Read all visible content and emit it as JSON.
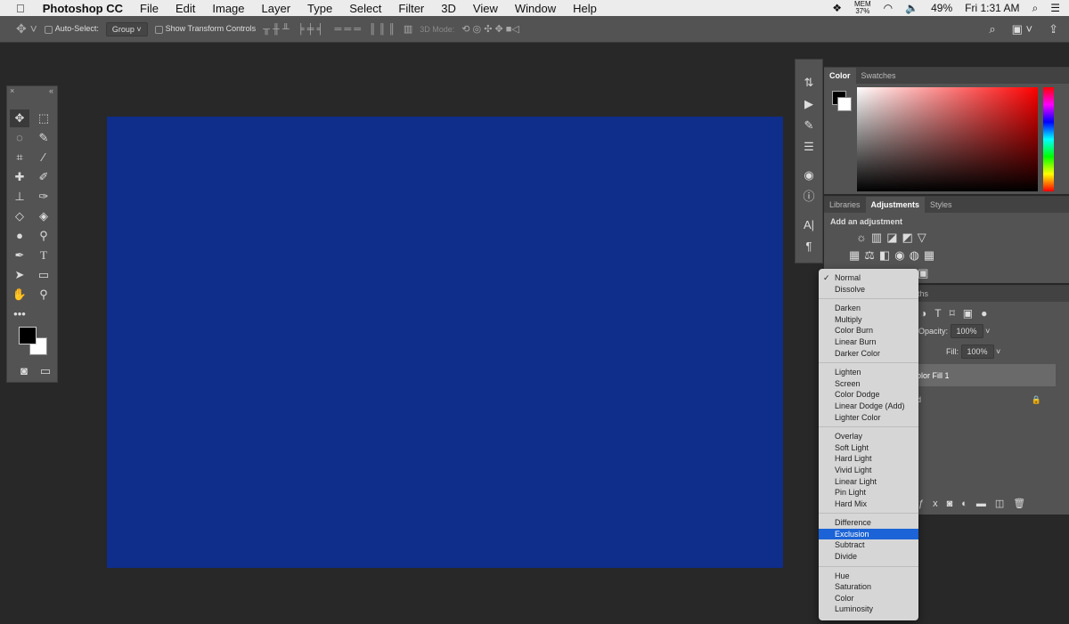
{
  "menubar": {
    "app": "Photoshop CC",
    "items": [
      "File",
      "Edit",
      "Image",
      "Layer",
      "Type",
      "Select",
      "Filter",
      "3D",
      "View",
      "Window",
      "Help"
    ],
    "mem_label": "MEM",
    "mem_value": "37%",
    "battery": "49%",
    "clock": "Fri 1:31 AM"
  },
  "options": {
    "auto_select": "Auto-Select:",
    "auto_select_value": "Group",
    "show_transform": "Show Transform Controls",
    "mode_3d": "3D Mode:"
  },
  "canvas": {
    "fill_color": "#0f2d8a"
  },
  "color_panel": {
    "tabs": [
      "Color",
      "Swatches"
    ],
    "active": "Color"
  },
  "adjust_panel": {
    "tabs": [
      "Libraries",
      "Adjustments",
      "Styles"
    ],
    "active": "Adjustments",
    "heading": "Add an adjustment"
  },
  "layers_panel": {
    "tab_partial": "aths",
    "opacity_label": "Opacity:",
    "opacity": "100%",
    "fill_label": "Fill:",
    "fill": "100%",
    "layers": [
      "olor Fill 1",
      "d"
    ]
  },
  "blend_menu": {
    "selected": "Normal",
    "highlighted": "Exclusion",
    "groups": [
      [
        "Normal",
        "Dissolve"
      ],
      [
        "Darken",
        "Multiply",
        "Color Burn",
        "Linear Burn",
        "Darker Color"
      ],
      [
        "Lighten",
        "Screen",
        "Color Dodge",
        "Linear Dodge (Add)",
        "Lighter Color"
      ],
      [
        "Overlay",
        "Soft Light",
        "Hard Light",
        "Vivid Light",
        "Linear Light",
        "Pin Light",
        "Hard Mix"
      ],
      [
        "Difference",
        "Exclusion",
        "Subtract",
        "Divide"
      ],
      [
        "Hue",
        "Saturation",
        "Color",
        "Luminosity"
      ]
    ]
  }
}
